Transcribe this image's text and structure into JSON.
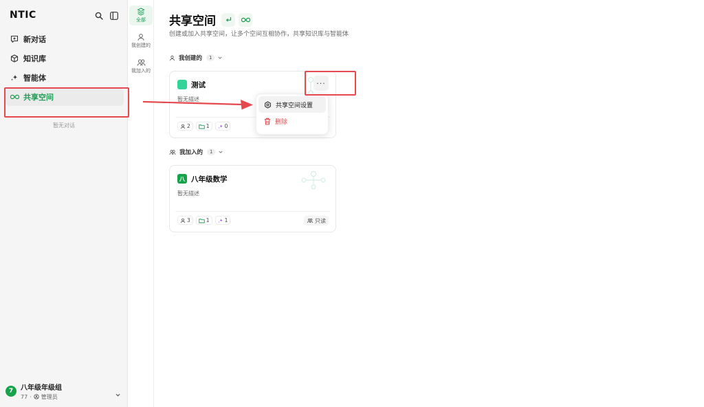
{
  "brand": {
    "name": "NTIC"
  },
  "sidebar": {
    "items": [
      {
        "label": "新对话",
        "icon": "new-chat-icon"
      },
      {
        "label": "知识库",
        "icon": "cube-icon"
      },
      {
        "label": "智能体",
        "icon": "sparkle-icon"
      },
      {
        "label": "共享空间",
        "icon": "infinity-icon",
        "active": true
      }
    ],
    "empty_chats": "暂无对话"
  },
  "user": {
    "avatar_initial": "7",
    "name": "八年级年级组",
    "id": "77",
    "role": "管理员"
  },
  "filters": [
    {
      "label": "全部",
      "icon": "layers-icon",
      "active": true
    },
    {
      "label": "我创建的",
      "icon": "user-icon"
    },
    {
      "label": "我加入的",
      "icon": "users-icon"
    }
  ],
  "header": {
    "title": "共享空间",
    "subtitle": "创建或加入共享空间，让多个空间互相协作，共享知识库与智能体"
  },
  "sections": {
    "created": {
      "label": "我创建的",
      "count": "1"
    },
    "joined": {
      "label": "我加入的",
      "count": "1"
    }
  },
  "cards": {
    "test": {
      "icon_text": "",
      "title": "测试",
      "desc": "暂无描述",
      "members": "2",
      "kbs": "1",
      "agents": "0",
      "more": "···"
    },
    "math": {
      "icon_text": "八",
      "title": "八年级数学",
      "desc": "暂无描述",
      "members": "3",
      "kbs": "1",
      "agents": "1",
      "readonly": "只读"
    }
  },
  "dropdown": {
    "settings": "共享空间设置",
    "delete": "删除"
  },
  "colors": {
    "accent": "#1f9d55",
    "danger": "#e5484d",
    "annotation": "#e5484d"
  }
}
